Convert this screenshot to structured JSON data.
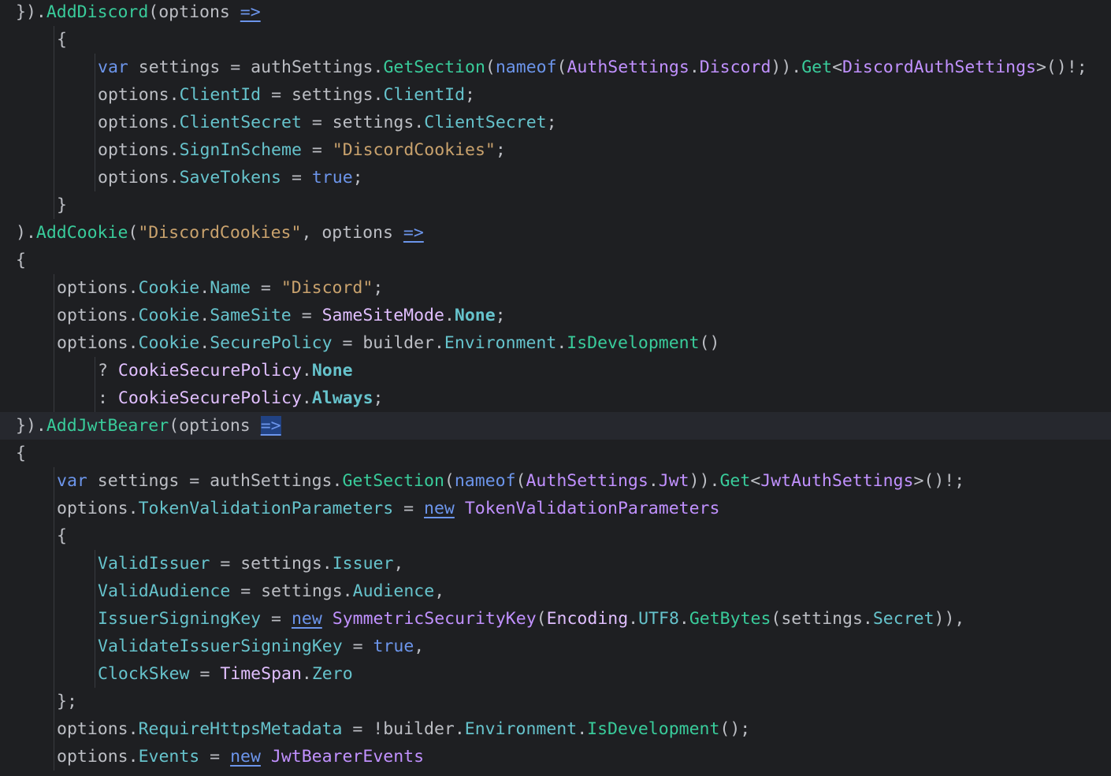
{
  "editor": {
    "colors": {
      "background": "#1e1f22",
      "current_line": "#26282e",
      "keyword": "#6c95eb",
      "method": "#39cc9b",
      "property": "#66c3cc",
      "type": "#c191ff",
      "string": "#c9a26d",
      "plain": "#bcbec4"
    },
    "lines": [
      {
        "indent": 0,
        "tokens": [
          [
            "plain",
            "})."
          ],
          [
            "method",
            "AddDiscord"
          ],
          [
            "plain",
            "(options "
          ],
          [
            "lambda",
            "=>"
          ]
        ]
      },
      {
        "indent": 1,
        "tokens": [
          [
            "plain",
            "{"
          ]
        ]
      },
      {
        "indent": 2,
        "tokens": [
          [
            "kw",
            "var"
          ],
          [
            "plain",
            " settings = authSettings."
          ],
          [
            "method",
            "GetSection"
          ],
          [
            "plain",
            "("
          ],
          [
            "kw",
            "nameof"
          ],
          [
            "plain",
            "("
          ],
          [
            "type",
            "AuthSettings"
          ],
          [
            "plain",
            "."
          ],
          [
            "type",
            "Discord"
          ],
          [
            "plain",
            "))."
          ],
          [
            "method",
            "Get"
          ],
          [
            "plain",
            "<"
          ],
          [
            "type",
            "DiscordAuthSettings"
          ],
          [
            "plain",
            ">()!;"
          ]
        ]
      },
      {
        "indent": 2,
        "tokens": [
          [
            "plain",
            "options."
          ],
          [
            "prop",
            "ClientId"
          ],
          [
            "plain",
            " = settings."
          ],
          [
            "prop",
            "ClientId"
          ],
          [
            "plain",
            ";"
          ]
        ]
      },
      {
        "indent": 2,
        "tokens": [
          [
            "plain",
            "options."
          ],
          [
            "prop",
            "ClientSecret"
          ],
          [
            "plain",
            " = settings."
          ],
          [
            "prop",
            "ClientSecret"
          ],
          [
            "plain",
            ";"
          ]
        ]
      },
      {
        "indent": 2,
        "tokens": [
          [
            "plain",
            "options."
          ],
          [
            "prop",
            "SignInScheme"
          ],
          [
            "plain",
            " = "
          ],
          [
            "str",
            "\"DiscordCookies\""
          ],
          [
            "plain",
            ";"
          ]
        ]
      },
      {
        "indent": 2,
        "tokens": [
          [
            "plain",
            "options."
          ],
          [
            "prop",
            "SaveTokens"
          ],
          [
            "plain",
            " = "
          ],
          [
            "kw",
            "true"
          ],
          [
            "plain",
            ";"
          ]
        ]
      },
      {
        "indent": 1,
        "tokens": [
          [
            "plain",
            "}"
          ]
        ]
      },
      {
        "indent": 0,
        "tokens": [
          [
            "plain",
            ")."
          ],
          [
            "method",
            "AddCookie"
          ],
          [
            "plain",
            "("
          ],
          [
            "str",
            "\"DiscordCookies\""
          ],
          [
            "plain",
            ", options "
          ],
          [
            "lambda",
            "=>"
          ]
        ]
      },
      {
        "indent": 0,
        "tokens": [
          [
            "plain",
            "{"
          ]
        ]
      },
      {
        "indent": 1,
        "tokens": [
          [
            "plain",
            "options."
          ],
          [
            "prop",
            "Cookie"
          ],
          [
            "plain",
            "."
          ],
          [
            "prop",
            "Name"
          ],
          [
            "plain",
            " = "
          ],
          [
            "str",
            "\"Discord\""
          ],
          [
            "plain",
            ";"
          ]
        ]
      },
      {
        "indent": 1,
        "tokens": [
          [
            "plain",
            "options."
          ],
          [
            "prop",
            "Cookie"
          ],
          [
            "plain",
            "."
          ],
          [
            "prop",
            "SameSite"
          ],
          [
            "plain",
            " = "
          ],
          [
            "enum",
            "SameSiteMode"
          ],
          [
            "plain",
            "."
          ],
          [
            "enumval",
            "None"
          ],
          [
            "plain",
            ";"
          ]
        ]
      },
      {
        "indent": 1,
        "tokens": [
          [
            "plain",
            "options."
          ],
          [
            "prop",
            "Cookie"
          ],
          [
            "plain",
            "."
          ],
          [
            "prop",
            "SecurePolicy"
          ],
          [
            "plain",
            " = builder."
          ],
          [
            "prop",
            "Environment"
          ],
          [
            "plain",
            "."
          ],
          [
            "method",
            "IsDevelopment"
          ],
          [
            "plain",
            "()"
          ]
        ]
      },
      {
        "indent": 2,
        "tokens": [
          [
            "plain",
            "? "
          ],
          [
            "enum",
            "CookieSecurePolicy"
          ],
          [
            "plain",
            "."
          ],
          [
            "enumval",
            "None"
          ]
        ]
      },
      {
        "indent": 2,
        "tokens": [
          [
            "plain",
            ": "
          ],
          [
            "enum",
            "CookieSecurePolicy"
          ],
          [
            "plain",
            "."
          ],
          [
            "enumval",
            "Always"
          ],
          [
            "plain",
            ";"
          ]
        ]
      },
      {
        "indent": 0,
        "current": true,
        "tokens": [
          [
            "plain",
            "})."
          ],
          [
            "method",
            "AddJwtBearer"
          ],
          [
            "plain",
            "(options "
          ],
          [
            "lambdahl",
            "=>"
          ]
        ]
      },
      {
        "indent": 0,
        "tokens": [
          [
            "plain",
            "{"
          ]
        ]
      },
      {
        "indent": 1,
        "tokens": [
          [
            "kw",
            "var"
          ],
          [
            "plain",
            " settings = authSettings."
          ],
          [
            "method",
            "GetSection"
          ],
          [
            "plain",
            "("
          ],
          [
            "kw",
            "nameof"
          ],
          [
            "plain",
            "("
          ],
          [
            "type",
            "AuthSettings"
          ],
          [
            "plain",
            "."
          ],
          [
            "type",
            "Jwt"
          ],
          [
            "plain",
            "))."
          ],
          [
            "method",
            "Get"
          ],
          [
            "plain",
            "<"
          ],
          [
            "type",
            "JwtAuthSettings"
          ],
          [
            "plain",
            ">()!;"
          ]
        ]
      },
      {
        "indent": 1,
        "tokens": [
          [
            "plain",
            "options."
          ],
          [
            "prop",
            "TokenValidationParameters"
          ],
          [
            "plain",
            " = "
          ],
          [
            "kwul",
            "new"
          ],
          [
            "plain",
            " "
          ],
          [
            "type",
            "TokenValidationParameters"
          ]
        ]
      },
      {
        "indent": 1,
        "tokens": [
          [
            "plain",
            "{"
          ]
        ]
      },
      {
        "indent": 2,
        "tokens": [
          [
            "prop",
            "ValidIssuer"
          ],
          [
            "plain",
            " = settings."
          ],
          [
            "prop",
            "Issuer"
          ],
          [
            "plain",
            ","
          ]
        ]
      },
      {
        "indent": 2,
        "tokens": [
          [
            "prop",
            "ValidAudience"
          ],
          [
            "plain",
            " = settings."
          ],
          [
            "prop",
            "Audience"
          ],
          [
            "plain",
            ","
          ]
        ]
      },
      {
        "indent": 2,
        "tokens": [
          [
            "prop",
            "IssuerSigningKey"
          ],
          [
            "plain",
            " = "
          ],
          [
            "kwul",
            "new"
          ],
          [
            "plain",
            " "
          ],
          [
            "type",
            "SymmetricSecurityKey"
          ],
          [
            "plain",
            "("
          ],
          [
            "struct",
            "Encoding"
          ],
          [
            "plain",
            "."
          ],
          [
            "prop",
            "UTF8"
          ],
          [
            "plain",
            "."
          ],
          [
            "method",
            "GetBytes"
          ],
          [
            "plain",
            "(settings."
          ],
          [
            "prop",
            "Secret"
          ],
          [
            "plain",
            ")),"
          ]
        ]
      },
      {
        "indent": 2,
        "tokens": [
          [
            "prop",
            "ValidateIssuerSigningKey"
          ],
          [
            "plain",
            " = "
          ],
          [
            "kw",
            "true"
          ],
          [
            "plain",
            ","
          ]
        ]
      },
      {
        "indent": 2,
        "tokens": [
          [
            "prop",
            "ClockSkew"
          ],
          [
            "plain",
            " = "
          ],
          [
            "struct",
            "TimeSpan"
          ],
          [
            "plain",
            "."
          ],
          [
            "prop",
            "Zero"
          ]
        ]
      },
      {
        "indent": 1,
        "tokens": [
          [
            "plain",
            "};"
          ]
        ]
      },
      {
        "indent": 1,
        "tokens": [
          [
            "plain",
            "options."
          ],
          [
            "prop",
            "RequireHttpsMetadata"
          ],
          [
            "plain",
            " = !builder."
          ],
          [
            "prop",
            "Environment"
          ],
          [
            "plain",
            "."
          ],
          [
            "method",
            "IsDevelopment"
          ],
          [
            "plain",
            "();"
          ]
        ]
      },
      {
        "indent": 1,
        "tokens": [
          [
            "plain",
            "options."
          ],
          [
            "prop",
            "Events"
          ],
          [
            "plain",
            " = "
          ],
          [
            "kwul",
            "new"
          ],
          [
            "plain",
            " "
          ],
          [
            "type",
            "JwtBearerEvents"
          ]
        ]
      }
    ]
  }
}
